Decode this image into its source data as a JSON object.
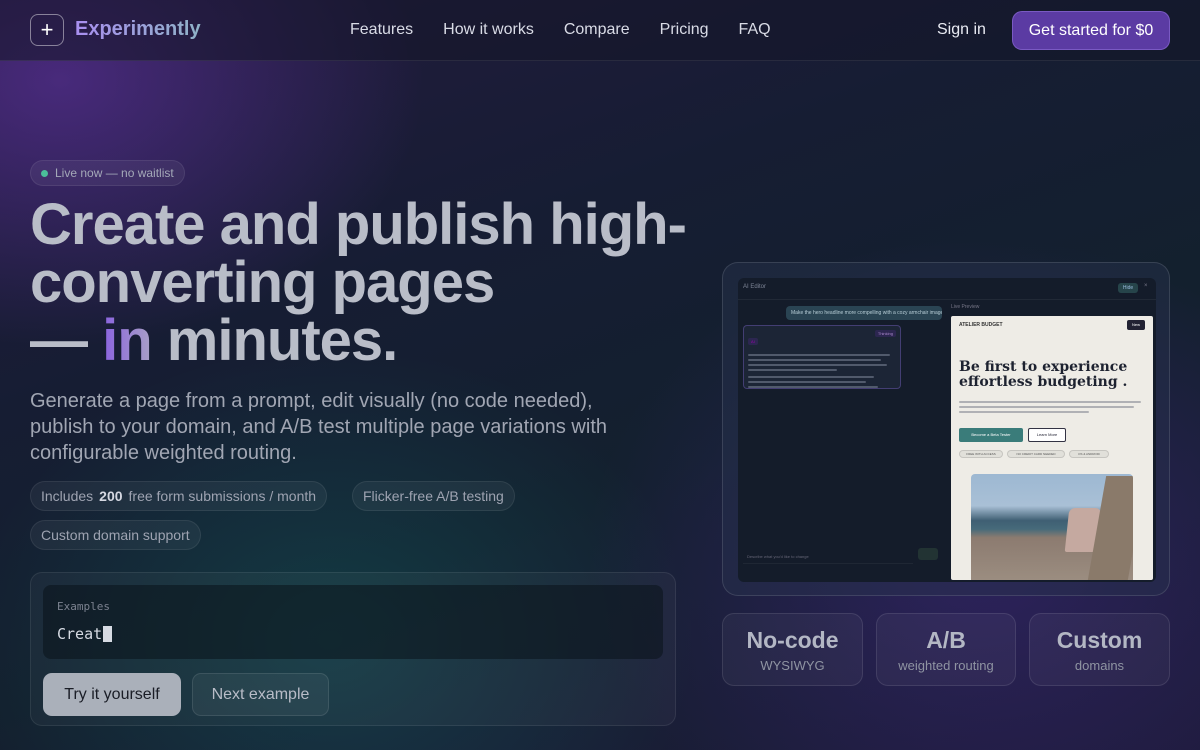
{
  "nav": {
    "logo_icon": "plus-icon",
    "brand": "Experimently",
    "links": [
      "Features",
      "How it works",
      "Compare",
      "Pricing",
      "FAQ"
    ],
    "signin": "Sign in",
    "cta": "Get started for $0"
  },
  "hero": {
    "badge": "Live now — no waitlist",
    "headline_line1": "Create and publish high-",
    "headline_line2": "converting pages",
    "headline_dash": "— ",
    "headline_accent": "in",
    "headline_end": " minutes.",
    "subhead": "Generate a page from a prompt, edit visually (no code needed), publish to your domain, and A/B test multiple page variations with configurable weighted routing.",
    "chips": {
      "includes_pre": "Includes",
      "includes_num": "200",
      "includes_post": "free form submissions / month",
      "flicker": "Flicker-free A/B testing",
      "domain": "Custom domain support"
    }
  },
  "prompt": {
    "label": "Examples",
    "typed": "Creat",
    "try_button": "Try it yourself",
    "next_button": "Next example"
  },
  "preview": {
    "editor_title": "AI Editor",
    "top_button": "Hide",
    "user_message": "Make the hero headline more compelling with a cozy armchair image",
    "ai_tag": "AI",
    "ai_tag2": "Thinking",
    "right_label": "Live Preview",
    "brand": "ATELIER BUDGET",
    "new_badge": "New",
    "page_headline": "Be first to experience effortless budgeting .",
    "button_primary": "Become a Beta Tester",
    "button_secondary": "Learn More",
    "tags": [
      "FREE WITH ACCESS",
      "NO CREDIT CARD NEEDED",
      "OS & ANDROID"
    ],
    "input_placeholder": "Describe what you'd like to change"
  },
  "features": [
    {
      "title": "No-code",
      "sub": "WYSIWYG"
    },
    {
      "title": "A/B",
      "sub": "weighted routing"
    },
    {
      "title": "Custom",
      "sub": "domains"
    }
  ]
}
